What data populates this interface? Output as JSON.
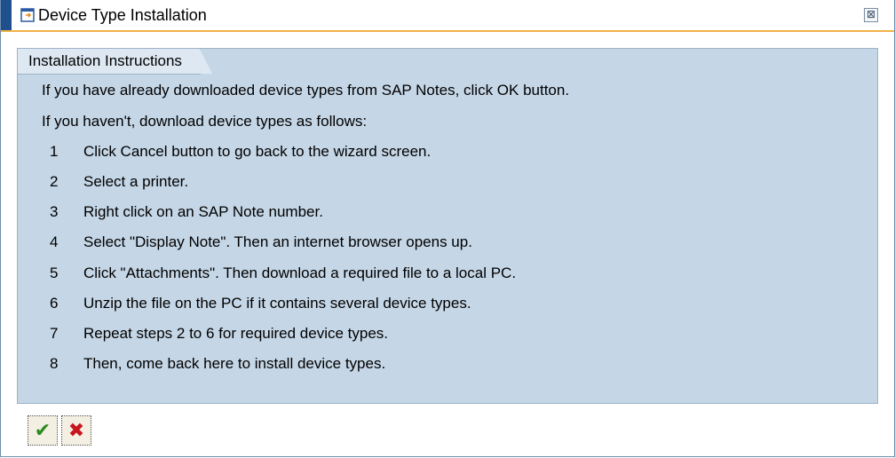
{
  "dialog": {
    "title": "Device Type Installation",
    "title_icon": "dialog-window-icon",
    "close_icon": "close-icon",
    "close_glyph": "⊠"
  },
  "group": {
    "title": "Installation Instructions",
    "intro": [
      "If you have already downloaded device types from SAP Notes, click OK button.",
      "If you haven't, download device types as follows:"
    ],
    "steps": [
      {
        "num": "1",
        "text": "Click Cancel button to go back to the wizard screen."
      },
      {
        "num": "2",
        "text": "Select a printer."
      },
      {
        "num": "3",
        "text": "Right click on an SAP Note number."
      },
      {
        "num": "4",
        "text": "Select \"Display Note\". Then an internet browser opens up."
      },
      {
        "num": "5",
        "text": "Click \"Attachments\". Then download a required file to a local PC."
      },
      {
        "num": "6",
        "text": "Unzip the file on the PC if it contains several device types."
      },
      {
        "num": "7",
        "text": "Repeat steps 2 to 6 for required device types."
      },
      {
        "num": "8",
        "text": "Then, come back here to install device types."
      }
    ]
  },
  "toolbar": {
    "ok_glyph": "✔",
    "cancel_glyph": "✖",
    "ok_icon": "checkmark-icon",
    "cancel_icon": "cancel-x-icon"
  },
  "colors": {
    "title_accent": "#1f4f8c",
    "title_underline": "#f2b24a",
    "group_background": "#c5d6e6",
    "group_tab": "#dde8f2",
    "ok": "#2d8a1f",
    "cancel": "#c8141e"
  }
}
